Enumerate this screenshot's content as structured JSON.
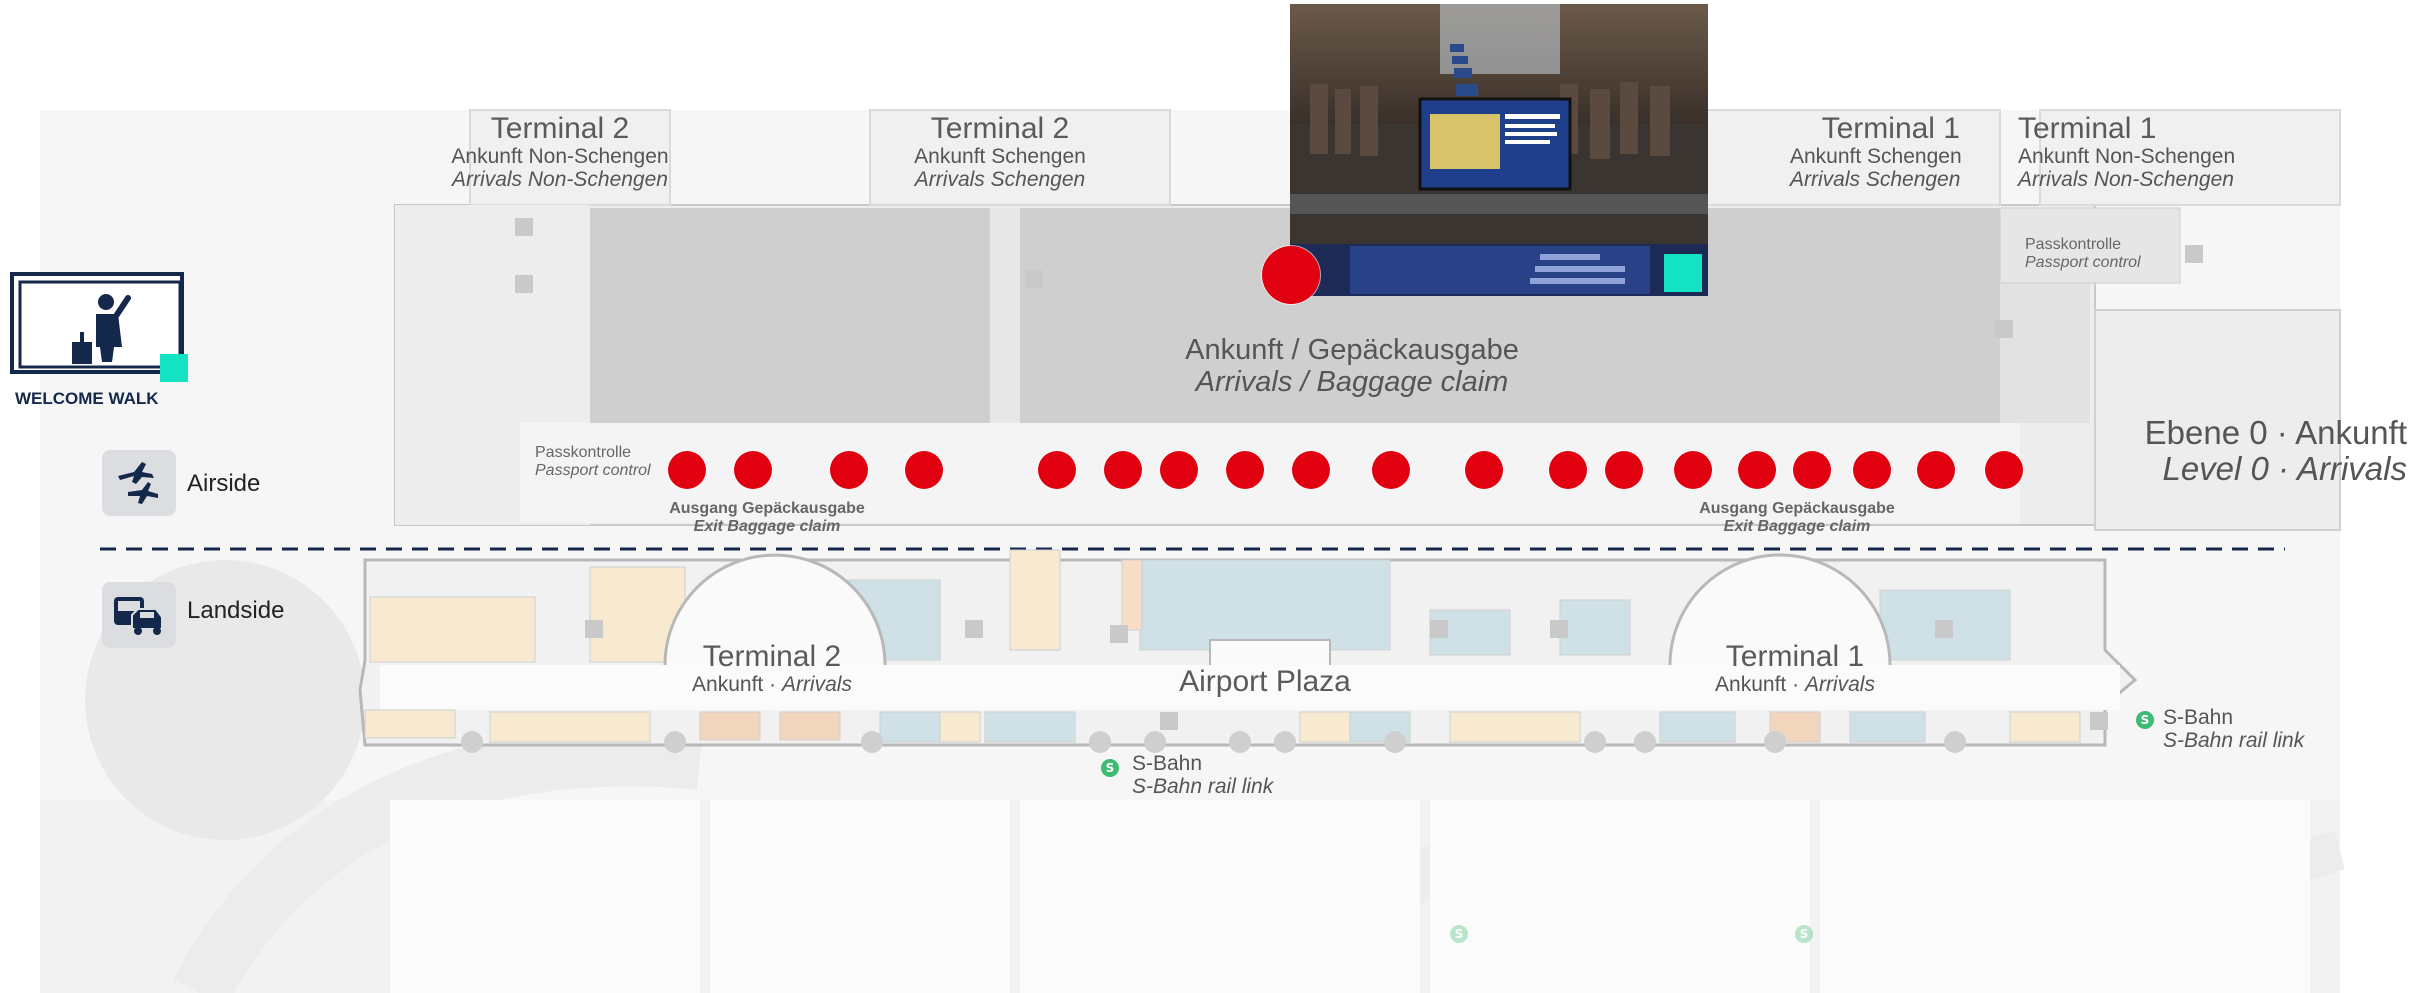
{
  "colors": {
    "marker_red": "#e0000f",
    "accent_teal": "#14e3c3",
    "navy": "#14284b"
  },
  "level": {
    "de": "Ebene 0 · Ankunft",
    "en": "Level 0 · Arrivals"
  },
  "logo": {
    "text": "WELCOME WALK",
    "icon": "person-with-luggage-icon"
  },
  "zones": {
    "airside": {
      "label": "Airside",
      "icon": "airplanes-icon"
    },
    "landside": {
      "label": "Landside",
      "icon": "bus-car-icon"
    }
  },
  "areas": {
    "t2_non_schengen": {
      "title": "Terminal 2",
      "de": "Ankunft Non-Schengen",
      "en": "Arrivals Non-Schengen"
    },
    "t2_schengen": {
      "title": "Terminal 2",
      "de": "Ankunft Schengen",
      "en": "Arrivals Schengen"
    },
    "t1_schengen": {
      "title": "Terminal 1",
      "de": "Ankunft Schengen",
      "en": "Arrivals Schengen"
    },
    "t1_non_schengen": {
      "title": "Terminal 1",
      "de": "Ankunft Non-Schengen",
      "en": "Arrivals Non-Schengen"
    },
    "baggage": {
      "de": "Ankunft / Gepäckausgabe",
      "en": "Arrivals / Baggage claim"
    },
    "passport_left": {
      "de": "Passkontrolle",
      "en": "Passport control"
    },
    "passport_right": {
      "de": "Passkontrolle",
      "en": "Passport control"
    },
    "exit_left": {
      "de": "Ausgang Gepäckausgabe",
      "en": "Exit Baggage claim"
    },
    "exit_right": {
      "de": "Ausgang Gepäckausgabe",
      "en": "Exit Baggage claim"
    },
    "t2_landside": {
      "title": "Terminal 2",
      "de": "Ankunft · ",
      "en": "Arrivals"
    },
    "t1_landside": {
      "title": "Terminal 1",
      "de": "Ankunft · ",
      "en": "Arrivals"
    },
    "plaza": {
      "title": "Airport Plaza"
    },
    "sbahn_center": {
      "de": "S-Bahn",
      "en": "S-Bahn rail link"
    },
    "sbahn_right": {
      "de": "S-Bahn",
      "en": "S-Bahn rail link"
    }
  },
  "markers_count": 19,
  "photo": {
    "alt": "Baggage claim digital screen photo"
  }
}
